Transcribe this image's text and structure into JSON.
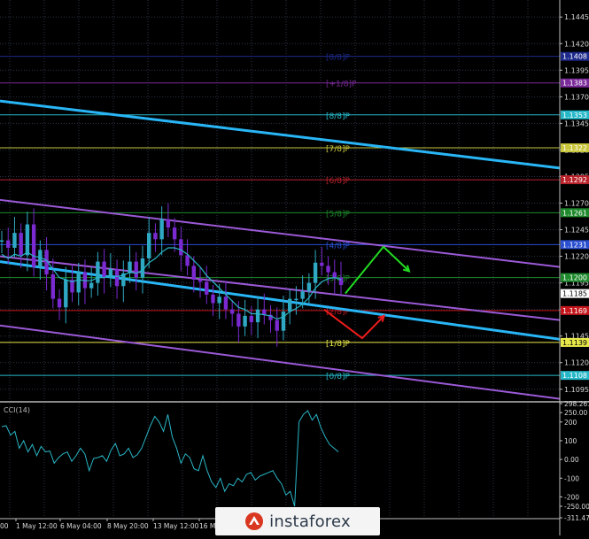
{
  "chart_data": [
    {
      "type": "line",
      "title": "",
      "ylim": [
        1.1084,
        1.1461
      ],
      "y_ticks": [
        "1.1445",
        "1.1420",
        "1.1395",
        "1.1370",
        "1.1345",
        "1.1320",
        "1.1295",
        "1.1270",
        "1.1245",
        "1.1220",
        "1.1195",
        "1.1170",
        "1.1145",
        "1.1120",
        "1.1095"
      ],
      "x_labels": [
        "1 May 12:00",
        "6 May 04:00",
        "8 May 20:00",
        "13 May 12:00",
        "16 May"
      ],
      "first_label_stub": "00",
      "price_series": [
        1.1235,
        1.1228,
        1.1242,
        1.1221,
        1.125,
        1.121,
        1.1226,
        1.1203,
        1.118,
        1.1172,
        1.1198,
        1.1186,
        1.1205,
        1.119,
        1.1195,
        1.1215,
        1.12,
        1.1208,
        1.1192,
        1.1204,
        1.1215,
        1.12,
        1.1218,
        1.1242,
        1.1236,
        1.1255,
        1.1247,
        1.1236,
        1.1221,
        1.1211,
        1.1198,
        1.1196,
        1.1184,
        1.1176,
        1.1182,
        1.117,
        1.1166,
        1.1154,
        1.1164,
        1.1158,
        1.117,
        1.1165,
        1.116,
        1.115,
        1.1168,
        1.118,
        1.118,
        1.1187,
        1.1195,
        1.1214,
        1.1211,
        1.1205,
        1.12,
        1.1193
      ],
      "ma_series": [
        1.1222,
        1.1218,
        1.1222,
        1.122,
        1.1224,
        1.122,
        1.1219,
        1.1216,
        1.1208,
        1.12,
        1.1198,
        1.1196,
        1.1198,
        1.1197,
        1.1197,
        1.12,
        1.12,
        1.1202,
        1.1201,
        1.1202,
        1.1205,
        1.1204,
        1.1207,
        1.1214,
        1.1218,
        1.1224,
        1.1228,
        1.1228,
        1.1226,
        1.1222,
        1.1216,
        1.121,
        1.1202,
        1.1196,
        1.119,
        1.1184,
        1.1178,
        1.1172,
        1.117,
        1.1166,
        1.1166,
        1.1165,
        1.1164,
        1.1161,
        1.1163,
        1.1168,
        1.1171,
        1.1175,
        1.1181,
        1.119,
        1.1196,
        1.1199,
        1.12,
        1.1198
      ],
      "price_labels": [
        {
          "value": 1.1408,
          "text": "1.1408",
          "color": "#1d2a8c"
        },
        {
          "value": 1.1383,
          "text": "1.1383",
          "color": "#7b2a9a"
        },
        {
          "value": 1.1353,
          "text": "1.1353",
          "color": "#27b8c8"
        },
        {
          "value": 1.1322,
          "text": "1.1322",
          "color": "#c8c63a"
        },
        {
          "value": 1.1292,
          "text": "1.1292",
          "color": "#b8222a"
        },
        {
          "value": 1.1261,
          "text": "1.1261",
          "color": "#1e8a2c"
        },
        {
          "value": 1.1231,
          "text": "1.1231",
          "color": "#2a4fd0"
        },
        {
          "value": 1.12,
          "text": "1.1200",
          "color": "#1e8a2c"
        },
        {
          "value": 1.1185,
          "text": "1.1185",
          "color": "#ffffff",
          "text_color": "#000000"
        },
        {
          "value": 1.1169,
          "text": "1.1169",
          "color": "#c4161c"
        },
        {
          "value": 1.1139,
          "text": "1.1139",
          "color": "#e8e84a",
          "text_color": "#000000"
        },
        {
          "value": 1.1108,
          "text": "1.1108",
          "color": "#27b8c8"
        }
      ],
      "murray_levels": [
        {
          "value": 1.1408,
          "label": "[8/8]P",
          "color": "#1d2a8c"
        },
        {
          "value": 1.1383,
          "label": "[+1/8]P",
          "color": "#7b2a9a"
        },
        {
          "value": 1.1353,
          "label": "[8/8]P",
          "color": "#27b8c8"
        },
        {
          "value": 1.1322,
          "label": "[7/8]P",
          "color": "#c8c63a"
        },
        {
          "value": 1.1292,
          "label": "[6/8]P",
          "color": "#b8222a"
        },
        {
          "value": 1.1261,
          "label": "[5/8]P",
          "color": "#1e8a2c"
        },
        {
          "value": 1.1231,
          "label": "[4/8]P",
          "color": "#2a4fd0"
        },
        {
          "value": 1.12,
          "label": "[3/8]P",
          "color": "#1e8a2c"
        },
        {
          "value": 1.1169,
          "label": "[2/8]P",
          "color": "#c4161c"
        },
        {
          "value": 1.1139,
          "label": "[1/8]P",
          "color": "#e8e84a"
        },
        {
          "value": 1.1108,
          "label": "[0/8]P",
          "color": "#27b8c8"
        }
      ],
      "trendlines": [
        {
          "name": "blue-channel-upper",
          "from": [
            0,
            1.1366
          ],
          "to": [
            1,
            1.1303
          ],
          "color": "#29b6f6"
        },
        {
          "name": "blue-channel-lower",
          "from": [
            0,
            1.1215
          ],
          "to": [
            1,
            1.1142
          ],
          "color": "#29b6f6"
        },
        {
          "name": "purple-channel-upper",
          "from": [
            0,
            1.1273
          ],
          "to": [
            1,
            1.121
          ],
          "color": "#9b59d6"
        },
        {
          "name": "purple-channel-mid",
          "from": [
            0,
            1.122
          ],
          "to": [
            1,
            1.116
          ],
          "color": "#9b59d6"
        },
        {
          "name": "purple-channel-lower",
          "from": [
            0,
            1.1155
          ],
          "to": [
            1,
            1.1086
          ],
          "color": "#9b59d6"
        }
      ],
      "forecast_up": [
        [
          0.617,
          1.1185
        ],
        [
          0.685,
          1.1229
        ],
        [
          0.731,
          1.1206
        ]
      ],
      "forecast_down": [
        [
          0.579,
          1.117
        ],
        [
          0.647,
          1.1143
        ],
        [
          0.686,
          1.1164
        ]
      ]
    },
    {
      "type": "line",
      "title": "CCI(14)",
      "ylim": [
        -311.478,
        298.2612
      ],
      "y_ticks": [
        "298.2612",
        "250.00",
        "200",
        "100",
        "0.00",
        "-100",
        "-200",
        "-250.00",
        "-311.478"
      ],
      "values": [
        175,
        180,
        130,
        150,
        60,
        100,
        40,
        80,
        20,
        70,
        40,
        45,
        -20,
        10,
        30,
        40,
        -10,
        20,
        60,
        30,
        -60,
        5,
        10,
        20,
        -10,
        50,
        85,
        20,
        30,
        60,
        10,
        25,
        60,
        120,
        180,
        230,
        200,
        150,
        240,
        120,
        60,
        -20,
        30,
        10,
        -50,
        -60,
        20,
        -60,
        -120,
        -150,
        -100,
        -170,
        -130,
        -140,
        -100,
        -120,
        -80,
        -70,
        -110,
        -90,
        -80,
        -70,
        -60,
        -100,
        -130,
        -190,
        -170,
        -250,
        200,
        240,
        260,
        210,
        240,
        170,
        120,
        80,
        60,
        40
      ]
    }
  ],
  "watermark": {
    "brand": "instaforex"
  },
  "colors": {
    "background": "#000000",
    "grid": "#1a1f2a",
    "axis": "#c0c0c0",
    "candle_up": "#2fa8c4",
    "candle_down": "#7a2ad0",
    "ma": "#29b6c6",
    "cci": "#29b6c6"
  }
}
